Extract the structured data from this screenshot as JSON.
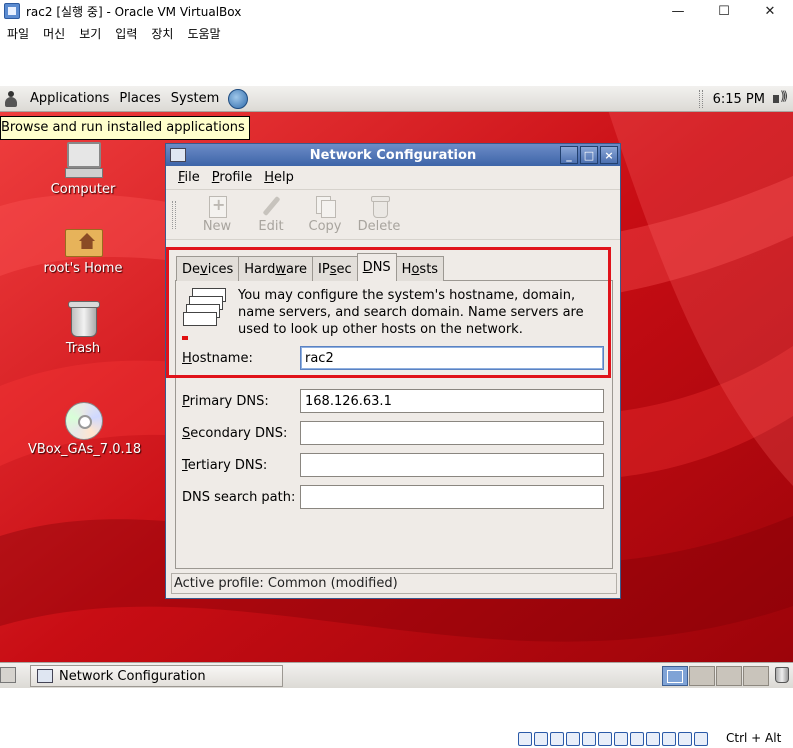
{
  "host": {
    "title": "rac2 [실행 중] - Oracle VM VirtualBox",
    "window_buttons": {
      "minimize": "—",
      "maximize": "☐",
      "close": "✕"
    },
    "menu": [
      "파일",
      "머신",
      "보기",
      "입력",
      "장치",
      "도움말"
    ],
    "host_key": "Ctrl + Alt"
  },
  "panel": {
    "menus": [
      "Applications",
      "Places",
      "System"
    ],
    "clock": "6:15 PM"
  },
  "tooltip": "Browse and run installed applications",
  "desktop_icons": [
    "Computer",
    "root's Home",
    "Trash",
    "VBox_GAs_7.0.18"
  ],
  "netconf": {
    "title": "Network Configuration",
    "window_controls": {
      "minimize": "_",
      "maximize": "□",
      "close": "×"
    },
    "menu": [
      {
        "accel": "F",
        "rest": "ile"
      },
      {
        "accel": "P",
        "rest": "rofile"
      },
      {
        "accel": "H",
        "rest": "elp"
      }
    ],
    "toolbar": [
      "New",
      "Edit",
      "Copy",
      "Delete"
    ],
    "tabs": {
      "devices": {
        "a": "De",
        "u": "v",
        "b": "ices"
      },
      "hardware": {
        "a": "Hard",
        "u": "w",
        "b": "are"
      },
      "ipsec": {
        "a": "IP",
        "u": "s",
        "b": "ec"
      },
      "dns": {
        "a": "",
        "u": "D",
        "b": "NS"
      },
      "hosts": {
        "a": "H",
        "u": "o",
        "b": "sts"
      }
    },
    "dns": {
      "description": "You may configure the system's hostname, domain, name servers, and search domain. Name servers are used to look up other hosts on the network.",
      "hostname": {
        "u": "H",
        "rest": "ostname:",
        "value": "rac2"
      },
      "primary": {
        "u": "P",
        "rest": "rimary DNS:",
        "value": "168.126.63.1"
      },
      "secondary": {
        "u": "S",
        "rest": "econdary DNS:",
        "value": ""
      },
      "tertiary": {
        "u": "T",
        "rest": "ertiary DNS:",
        "value": ""
      },
      "search": {
        "label": "DNS search path:",
        "value": ""
      }
    },
    "status": "Active profile: Common (modified)"
  },
  "taskbar": {
    "task": "Network Configuration"
  },
  "colors": {
    "desktop_red": "#d5131a",
    "highlight": "#e0121a",
    "title_blue": "#3d64a8"
  }
}
